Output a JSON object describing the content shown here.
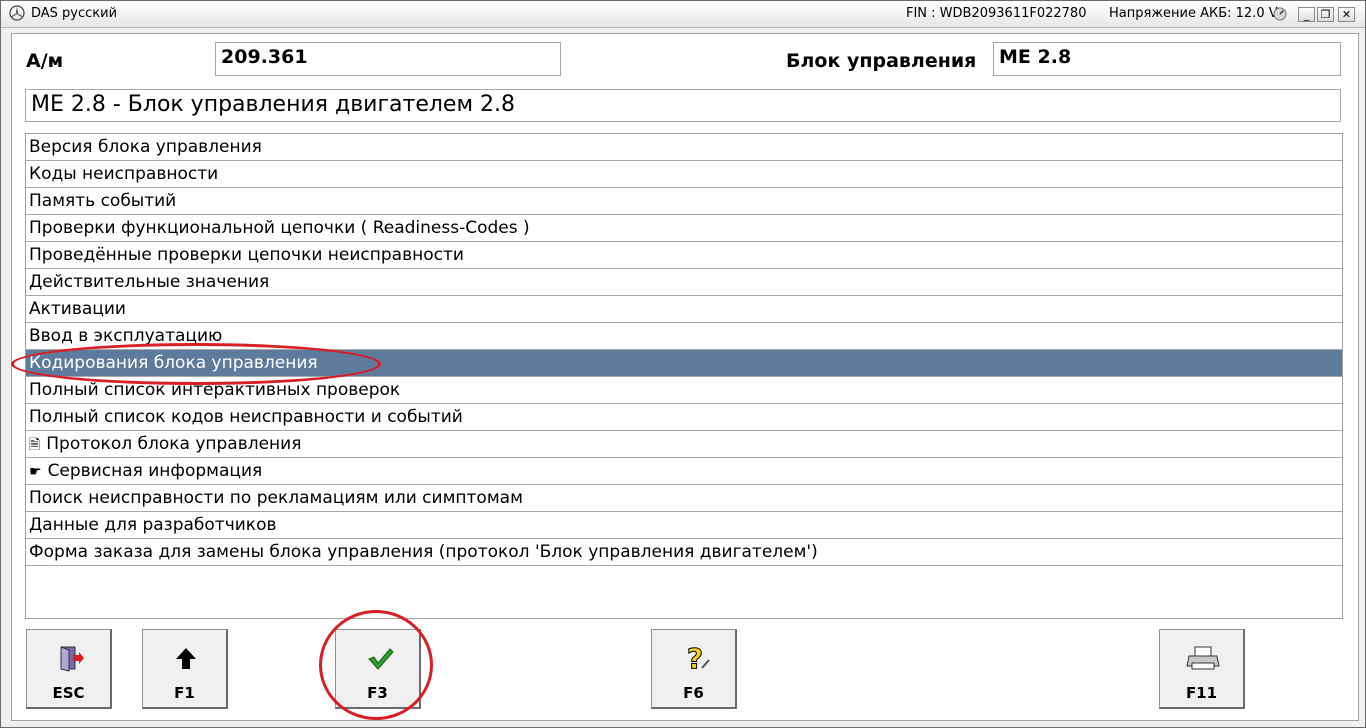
{
  "window": {
    "title": "DAS русский",
    "fin": "FIN : WDB2093611F022780",
    "voltage": "Напряжение АКБ: 12.0 V",
    "controls": [
      "minimize",
      "restore",
      "close"
    ]
  },
  "header": {
    "model_label": "А/м",
    "model_value": "209.361",
    "ecu_label": "Блок управления",
    "ecu_value": "ME 2.8",
    "description": "ME 2.8 - Блок управления двигателем 2.8"
  },
  "menu": {
    "items": [
      {
        "label": "Версия блока управления"
      },
      {
        "label": "Коды неисправности"
      },
      {
        "label": "Память событий"
      },
      {
        "label": "Проверки функциональной цепочки ( Readiness-Codes )"
      },
      {
        "label": "Проведённые проверки цепочки неисправности"
      },
      {
        "label": "Действительные значения"
      },
      {
        "label": "Активации"
      },
      {
        "label": "Ввод в эксплуатацию"
      },
      {
        "label": "Кодирования блока управления",
        "selected": true
      },
      {
        "label": "Полный список интерактивных проверок"
      },
      {
        "label": "Полный список кодов неисправности и событий"
      },
      {
        "label": "Протокол блока управления",
        "icon": "document-icon"
      },
      {
        "label": "Сервисная информация",
        "icon": "pointing-hand-icon"
      },
      {
        "label": "Поиск неисправности по рекламациям или симптомам"
      },
      {
        "label": "Данные для разработчиков"
      },
      {
        "label": "Форма заказа для замены блока управления (протокол 'Блок управления двигателем')"
      }
    ]
  },
  "toolbar": {
    "buttons": [
      {
        "key": "ESC",
        "icon": "exit-door-icon"
      },
      {
        "key": "F1",
        "icon": "arrow-up-icon"
      },
      {
        "key": "F3",
        "icon": "checkmark-icon"
      },
      {
        "key": "F6",
        "icon": "help-question-icon"
      },
      {
        "key": "F11",
        "icon": "printer-icon"
      }
    ]
  },
  "colors": {
    "selection": "#5e7a9c",
    "annotation": "#d81f26",
    "check": "#2e9e2e",
    "help": "#f2d21a"
  }
}
